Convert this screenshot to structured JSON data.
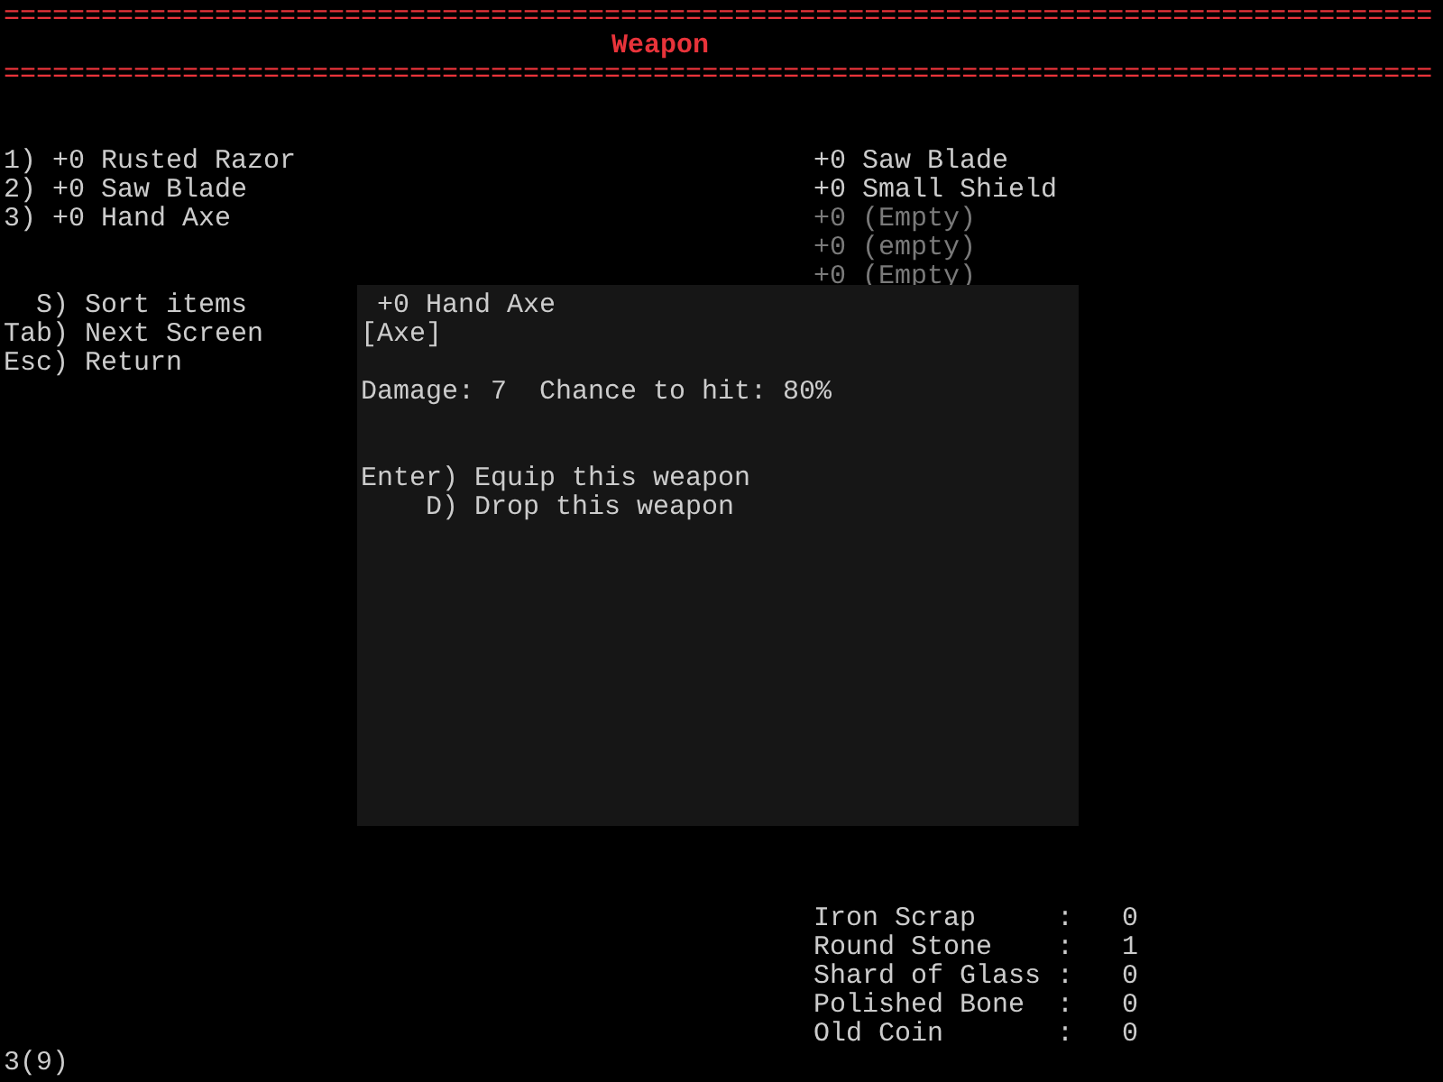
{
  "header": {
    "rule_top": "========================================================================================",
    "title": "Weapon",
    "rule_bottom": "========================================================================================"
  },
  "weapons": [
    {
      "key": "1)",
      "name": "+0 Rusted Razor"
    },
    {
      "key": "2)",
      "name": "+0 Saw Blade"
    },
    {
      "key": "3)",
      "name": "+0 Hand Axe"
    }
  ],
  "commands": [
    {
      "key": "S)",
      "label": "Sort items"
    },
    {
      "key": "Tab)",
      "label": "Next Screen"
    },
    {
      "key": "Esc)",
      "label": "Return"
    }
  ],
  "equipment": [
    {
      "name": "+0 Saw Blade",
      "empty": false
    },
    {
      "name": "+0 Small Shield",
      "empty": false
    },
    {
      "name": "+0 (Empty)",
      "empty": true
    },
    {
      "name": "+0 (empty)",
      "empty": true
    },
    {
      "name": "+0 (Empty)",
      "empty": true
    }
  ],
  "popup": {
    "title": "+0 Hand Axe",
    "type": "[Axe]",
    "stats": "Damage: 7  Chance to hit: 80%",
    "actions": [
      {
        "key": "Enter)",
        "label": "Equip this weapon"
      },
      {
        "key": "D)",
        "label": "Drop this weapon"
      }
    ]
  },
  "materials": [
    {
      "name": "Iron Scrap",
      "separator": ":",
      "count": "0"
    },
    {
      "name": "Round Stone",
      "separator": ":",
      "count": "1"
    },
    {
      "name": "Shard of Glass",
      "separator": ":",
      "count": "0"
    },
    {
      "name": "Polished Bone",
      "separator": ":",
      "count": "0"
    },
    {
      "name": "Old Coin",
      "separator": ":",
      "count": "0"
    }
  ],
  "footer": "3(9)"
}
